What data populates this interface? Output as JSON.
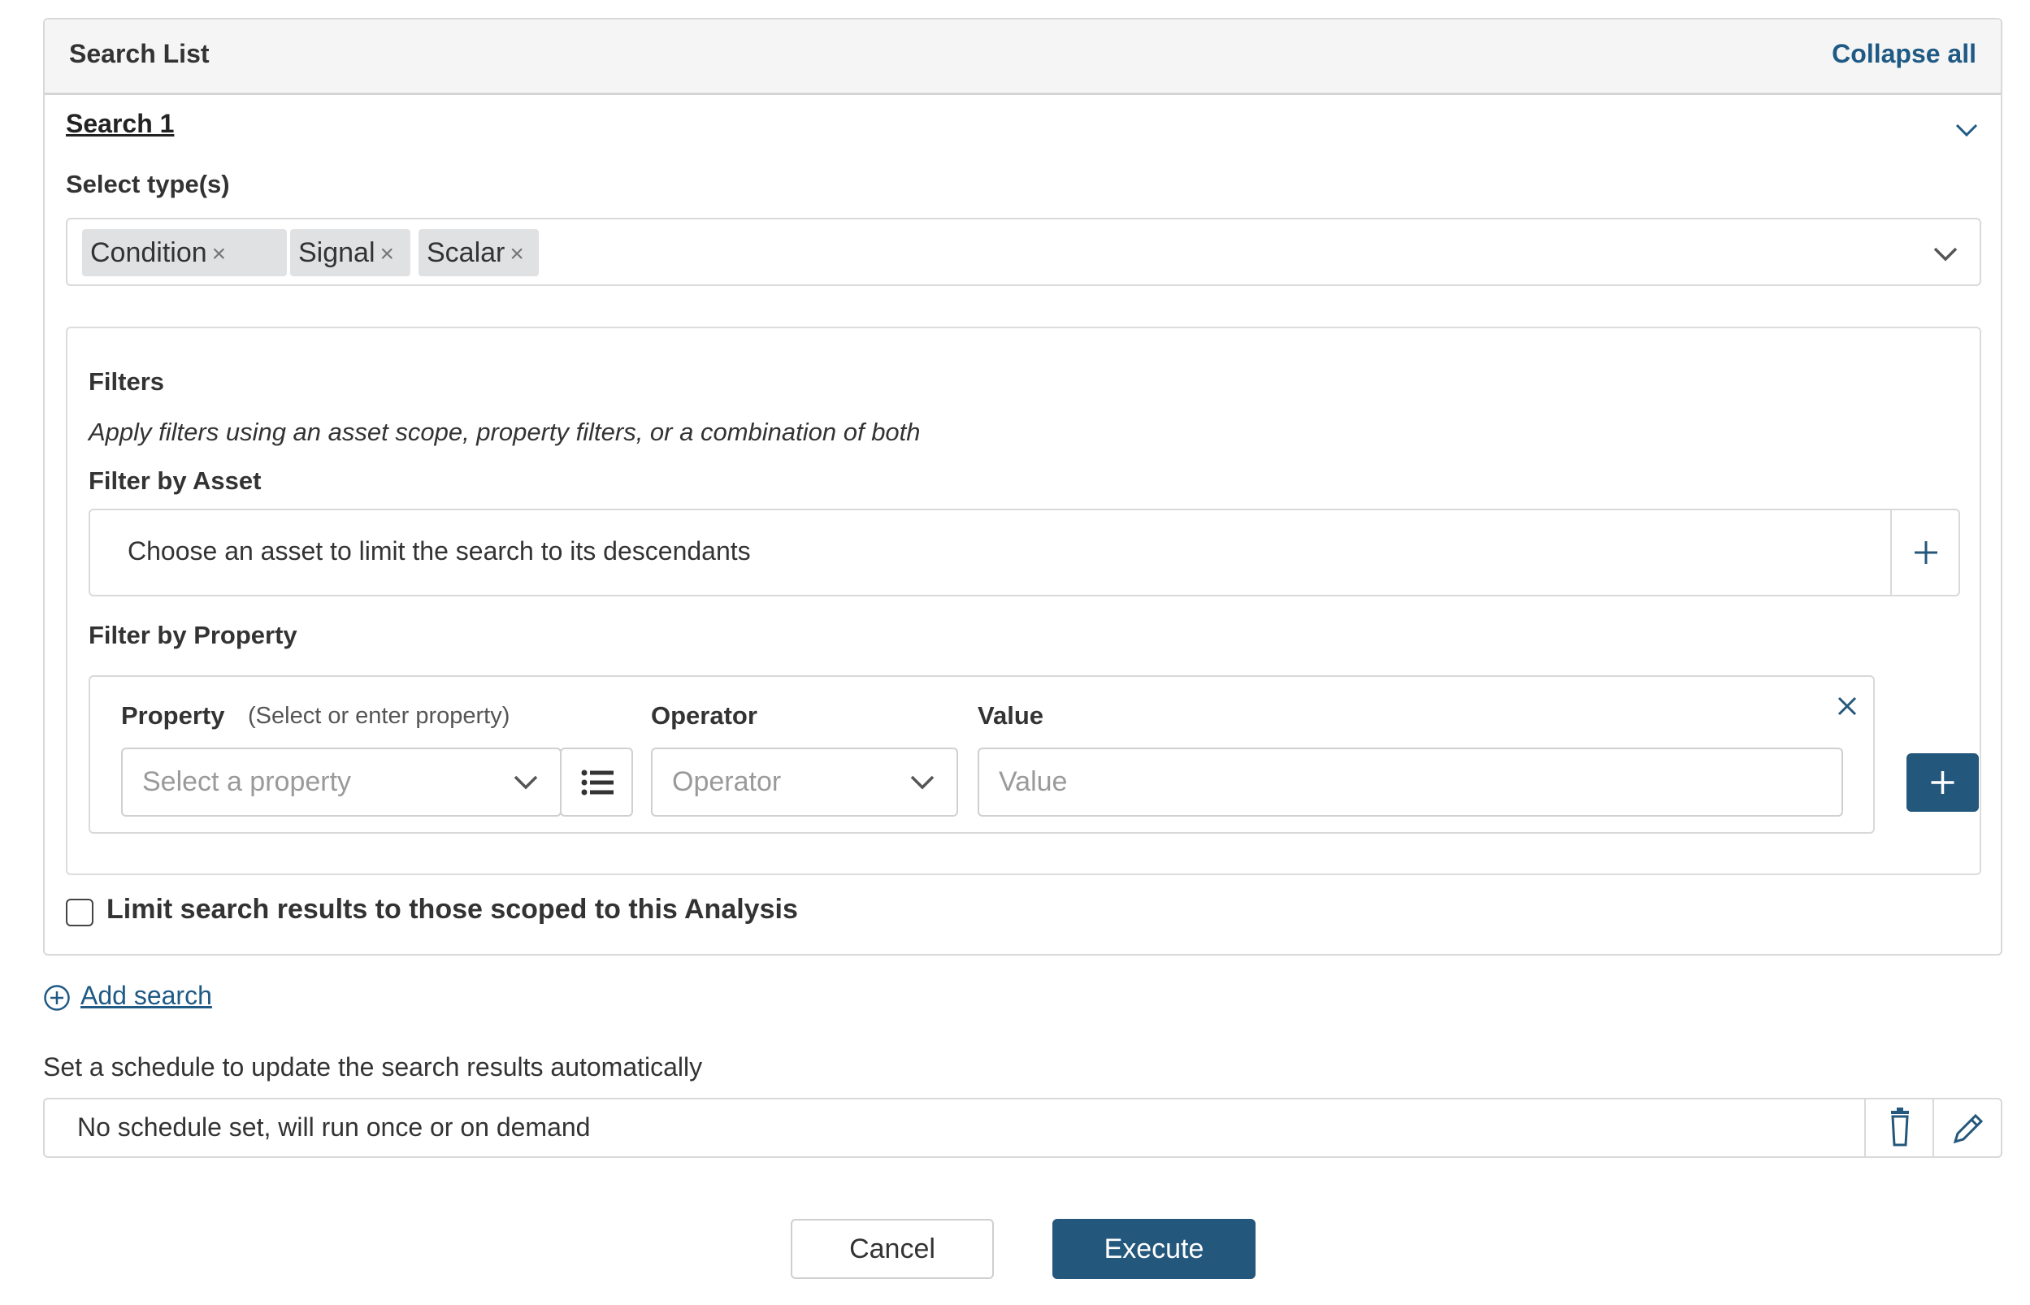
{
  "panel": {
    "title": "Search List",
    "collapse_label": "Collapse all"
  },
  "search": {
    "name": "Search 1",
    "types_label": "Select type(s)",
    "types": [
      {
        "label": "Condition",
        "remove": "×"
      },
      {
        "label": "Signal",
        "remove": "×"
      },
      {
        "label": "Scalar",
        "remove": "×"
      }
    ],
    "filters": {
      "title": "Filters",
      "subtitle": "Apply filters using an asset scope, property filters, or a combination of both",
      "asset_label": "Filter by Asset",
      "asset_placeholder": "Choose an asset to limit the search to its descendants",
      "property_section_label": "Filter by Property",
      "property": {
        "label": "Property",
        "hint": "(Select or enter property)",
        "placeholder": "Select a property",
        "operator_label": "Operator",
        "operator_placeholder": "Operator",
        "value_label": "Value",
        "value_placeholder": "Value"
      }
    },
    "limit_label": "Limit search results to those scoped to this Analysis",
    "limit_checked": false
  },
  "add_search_label": "Add search",
  "schedule": {
    "label": "Set a schedule to update the search results automatically",
    "value": "No schedule set, will run once or on demand"
  },
  "actions": {
    "cancel": "Cancel",
    "execute": "Execute"
  },
  "icons": {
    "collapse": "chevron-down-icon",
    "asset_add": "plus-icon",
    "property_list": "list-icon",
    "property_remove": "close-icon",
    "property_add": "plus-icon",
    "add_search": "circle-plus-icon",
    "schedule_delete": "trash-icon",
    "schedule_edit": "pencil-icon"
  },
  "colors": {
    "accent": "#24577c",
    "link": "#1f5a85",
    "chip_bg": "#dfe1e3"
  }
}
